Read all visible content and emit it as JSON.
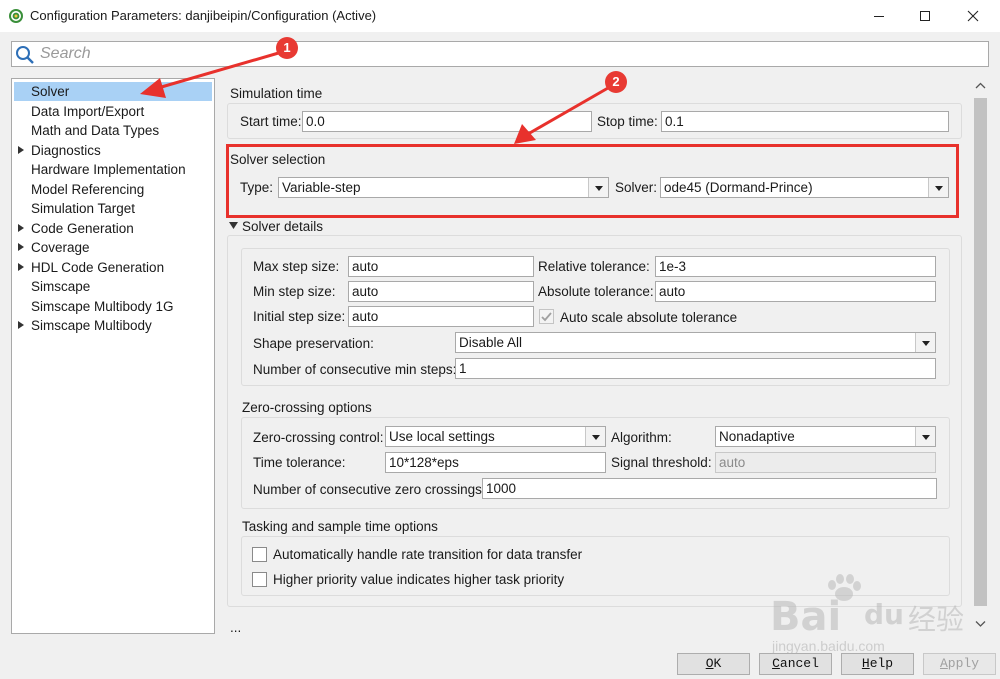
{
  "window": {
    "title": "Configuration Parameters: danjibeipin/Configuration (Active)",
    "controls": [
      "minimize",
      "maximize",
      "close"
    ]
  },
  "search": {
    "placeholder": "Search",
    "value": ""
  },
  "tree": {
    "items": [
      {
        "label": "Solver",
        "selected": true,
        "expandable": false
      },
      {
        "label": "Data Import/Export",
        "selected": false,
        "expandable": false
      },
      {
        "label": "Math and Data Types",
        "selected": false,
        "expandable": false
      },
      {
        "label": "Diagnostics",
        "selected": false,
        "expandable": true
      },
      {
        "label": "Hardware Implementation",
        "selected": false,
        "expandable": false
      },
      {
        "label": "Model Referencing",
        "selected": false,
        "expandable": false
      },
      {
        "label": "Simulation Target",
        "selected": false,
        "expandable": false
      },
      {
        "label": "Code Generation",
        "selected": false,
        "expandable": true
      },
      {
        "label": "Coverage",
        "selected": false,
        "expandable": true
      },
      {
        "label": "HDL Code Generation",
        "selected": false,
        "expandable": true
      },
      {
        "label": "Simscape",
        "selected": false,
        "expandable": false
      },
      {
        "label": "Simscape Multibody 1G",
        "selected": false,
        "expandable": false
      },
      {
        "label": "Simscape Multibody",
        "selected": false,
        "expandable": true
      }
    ]
  },
  "simulation_time": {
    "title": "Simulation time",
    "start_label": "Start time:",
    "start_value": "0.0",
    "stop_label": "Stop time:",
    "stop_value": "0.1"
  },
  "solver_selection": {
    "title": "Solver selection",
    "type_label": "Type:",
    "type_value": "Variable-step",
    "solver_label": "Solver:",
    "solver_value": "ode45 (Dormand-Prince)"
  },
  "solver_details": {
    "title": "Solver details",
    "max_step_label": "Max step size:",
    "max_step_value": "auto",
    "min_step_label": "Min step size:",
    "min_step_value": "auto",
    "initial_step_label": "Initial step size:",
    "initial_step_value": "auto",
    "rel_tol_label": "Relative tolerance:",
    "rel_tol_value": "1e-3",
    "abs_tol_label": "Absolute tolerance:",
    "abs_tol_value": "auto",
    "auto_scale_label": "Auto scale absolute tolerance",
    "auto_scale_checked": true,
    "shape_label": "Shape preservation:",
    "shape_value": "Disable All",
    "consec_min_label": "Number of consecutive min steps:",
    "consec_min_value": "1"
  },
  "zero_crossing": {
    "title": "Zero-crossing options",
    "control_label": "Zero-crossing control:",
    "control_value": "Use local settings",
    "algorithm_label": "Algorithm:",
    "algorithm_value": "Nonadaptive",
    "time_tol_label": "Time tolerance:",
    "time_tol_value": "10*128*eps",
    "signal_threshold_label": "Signal threshold:",
    "signal_threshold_value": "auto",
    "consec_zero_label": "Number of consecutive zero crossings:",
    "consec_zero_value": "1000"
  },
  "tasking": {
    "title": "Tasking and sample time options",
    "rate_transition_label": "Automatically handle rate transition for data transfer",
    "rate_transition_checked": false,
    "priority_label": "Higher priority value indicates higher task priority",
    "priority_checked": false
  },
  "more": {
    "label": "..."
  },
  "buttons": {
    "ok": {
      "mnemonic": "O",
      "rest": "K"
    },
    "cancel": {
      "mnemonic": "C",
      "rest": "ancel"
    },
    "help": {
      "mnemonic": "H",
      "rest": "elp"
    },
    "apply": {
      "mnemonic": "A",
      "rest": "pply",
      "enabled": false
    }
  },
  "annotations": {
    "badge1": "1",
    "badge2": "2",
    "color": "#e83a33"
  },
  "watermark": {
    "brand": "Bai",
    "brand2": "du",
    "cn": "经验",
    "url": "jingyan.baidu.com"
  },
  "colors": {
    "selection": "#a9d1f5",
    "highlight": "#e8312c"
  }
}
